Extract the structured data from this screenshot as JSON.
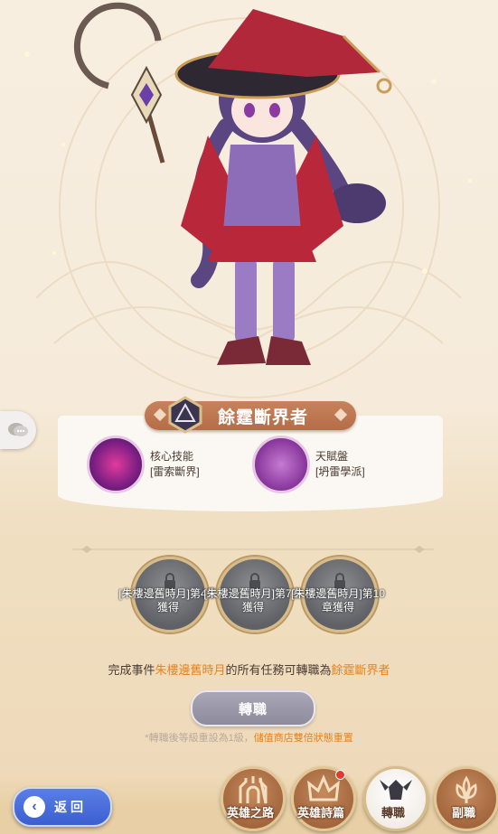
{
  "hero": {
    "name": "餘霆斷界者"
  },
  "skills": [
    {
      "title": "核心技能",
      "subtitle": "[雷索斷界]"
    },
    {
      "title": "天賦盤",
      "subtitle": "[坍雷學派]"
    }
  ],
  "locks": [
    {
      "text": "[朱樓邊舊時月]第4章獲得"
    },
    {
      "text": "[朱樓邊舊時月]第7章獲得"
    },
    {
      "text": "[朱樓邊舊時月]第10章獲得"
    }
  ],
  "condition": {
    "prefix": "完成事件",
    "event": "朱樓邊舊時月",
    "middle": "的所有任務可轉職為",
    "target": "餘霆斷界者"
  },
  "job_button": {
    "label": "轉職"
  },
  "note": {
    "prefix": "*轉職後等級重設為1級，",
    "highlight": "儲值商店雙倍狀態重置"
  },
  "back_button": {
    "label": "返回"
  },
  "nav": [
    {
      "label": "英雄之路",
      "active": false
    },
    {
      "label": "英雄詩篇",
      "active": false,
      "badge": true
    },
    {
      "label": "轉職",
      "active": true
    },
    {
      "label": "副職",
      "active": false
    }
  ],
  "colors": {
    "highlight": "#e7821c",
    "banner": "#b46d48",
    "back_button": "#3c5fd0",
    "gold_ring": "#d7bb8a"
  }
}
